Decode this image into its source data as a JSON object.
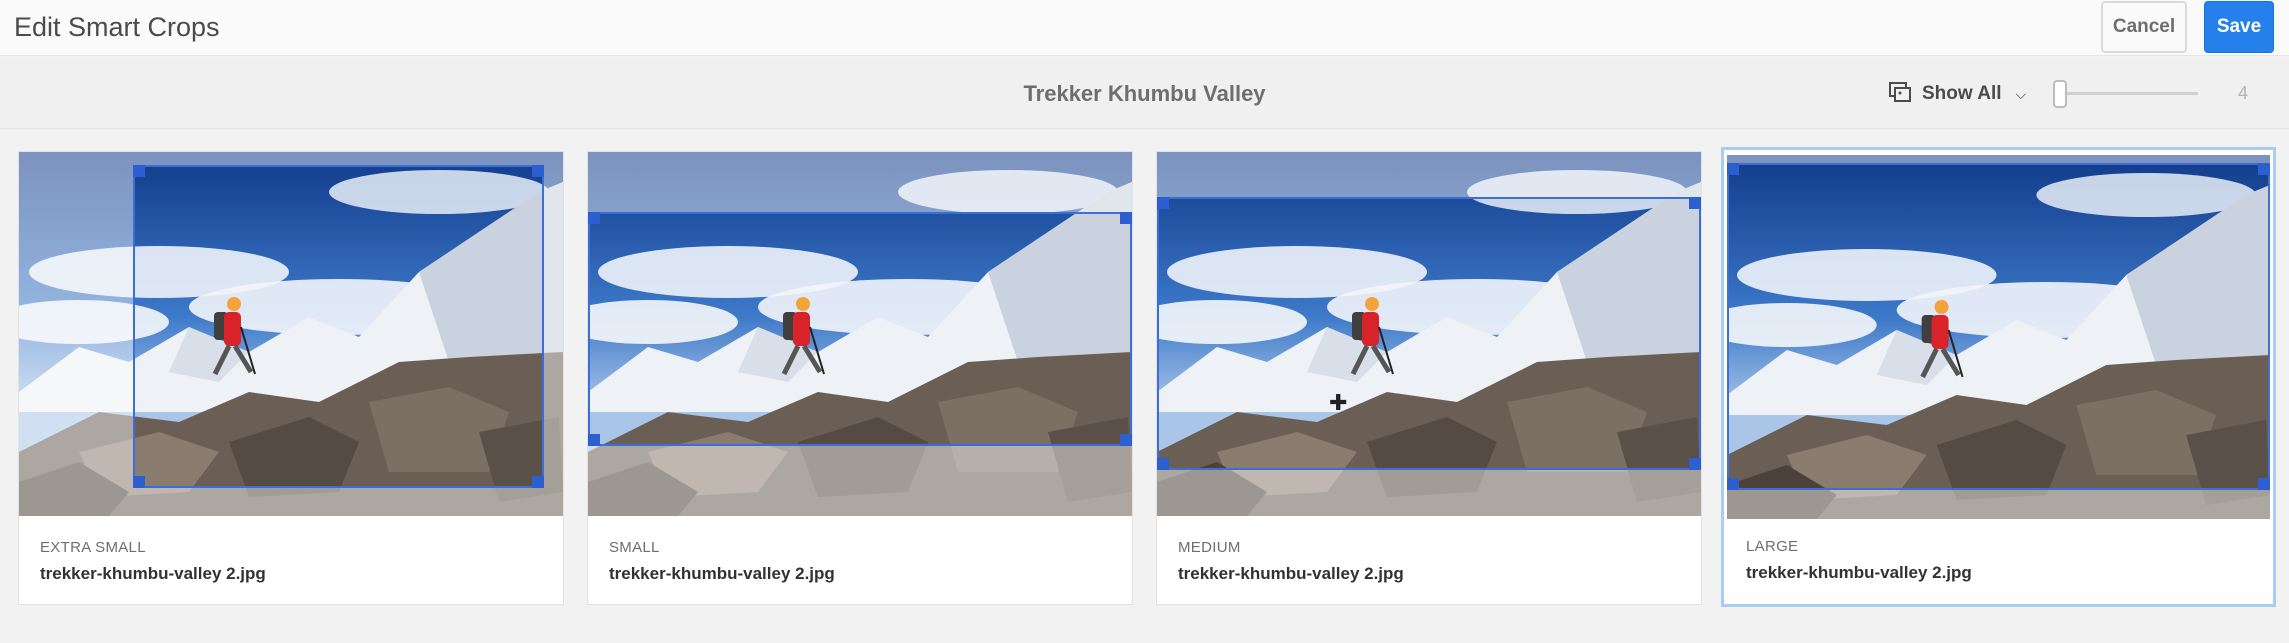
{
  "header": {
    "title": "Edit Smart Crops",
    "cancel_label": "Cancel",
    "save_label": "Save"
  },
  "toolbar": {
    "asset_title": "Trekker Khumbu Valley",
    "show_all_label": "Show All",
    "slider_value": "4"
  },
  "cards": [
    {
      "size": "EXTRA SMALL",
      "file": "trekker-khumbu-valley 2.jpg"
    },
    {
      "size": "SMALL",
      "file": "trekker-khumbu-valley 2.jpg"
    },
    {
      "size": "MEDIUM",
      "file": "trekker-khumbu-valley 2.jpg"
    },
    {
      "size": "LARGE",
      "file": "trekker-khumbu-valley 2.jpg"
    }
  ],
  "colors": {
    "accent": "#2680eb",
    "crop_border": "#3b6fd6",
    "selected_border": "#a9ccf2"
  },
  "icons": {
    "show_all": "image-grid-icon",
    "dropdown": "chevron-down-icon",
    "cursor": "crosshair-icon"
  }
}
